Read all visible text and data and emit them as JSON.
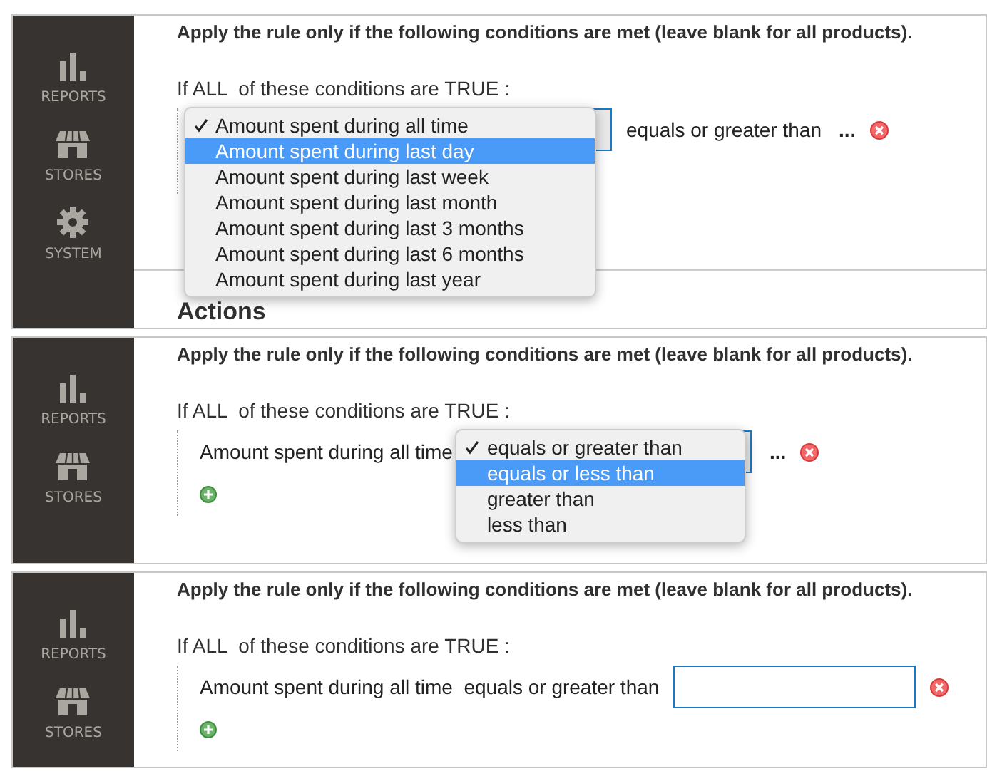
{
  "panels": [
    {
      "sidebar": [
        {
          "kind": "reports",
          "label": "REPORTS"
        },
        {
          "kind": "stores",
          "label": "STORES"
        },
        {
          "kind": "system",
          "label": "SYSTEM"
        }
      ],
      "heading": "Apply the rule only if the following conditions are met (leave blank for all products).",
      "rule": "If ALL  of these conditions are TRUE :",
      "condition": [
        {
          "kind": "select",
          "menu": [
            {
              "label": "Amount spent during all time",
              "checked": true,
              "selected": false
            },
            {
              "label": "Amount spent during last day",
              "checked": false,
              "selected": true
            },
            {
              "label": "Amount spent during last week",
              "checked": false,
              "selected": false
            },
            {
              "label": "Amount spent during last month",
              "checked": false,
              "selected": false
            },
            {
              "label": "Amount spent during last 3 months",
              "checked": false,
              "selected": false
            },
            {
              "label": "Amount spent during last 6 months",
              "checked": false,
              "selected": false
            },
            {
              "label": "Amount spent during last year",
              "checked": false,
              "selected": false
            }
          ]
        },
        {
          "kind": "text",
          "text": "equals or greater than"
        },
        {
          "kind": "link",
          "text": "..."
        },
        {
          "kind": "remove"
        }
      ],
      "section_title": "Actions"
    },
    {
      "sidebar": [
        {
          "kind": "reports",
          "label": "REPORTS"
        },
        {
          "kind": "stores",
          "label": "STORES"
        }
      ],
      "heading": "Apply the rule only if the following conditions are met (leave blank for all products).",
      "rule": "If ALL  of these conditions are TRUE :",
      "condition": [
        {
          "kind": "text",
          "text": "Amount spent during all time"
        },
        {
          "kind": "select",
          "menu": [
            {
              "label": "equals or greater than",
              "checked": true,
              "selected": false
            },
            {
              "label": "equals or less than",
              "checked": false,
              "selected": true
            },
            {
              "label": "greater than",
              "checked": false,
              "selected": false
            },
            {
              "label": "less than",
              "checked": false,
              "selected": false
            }
          ]
        },
        {
          "kind": "link",
          "text": "..."
        },
        {
          "kind": "remove"
        }
      ],
      "row_buttons": [
        {
          "kind": "add"
        }
      ]
    },
    {
      "sidebar": [
        {
          "kind": "reports",
          "label": "REPORTS"
        },
        {
          "kind": "stores",
          "label": "STORES"
        }
      ],
      "heading": "Apply the rule only if the following conditions are met (leave blank for all products).",
      "rule": "If ALL  of these conditions are TRUE :",
      "condition": [
        {
          "kind": "text",
          "text": "Amount spent during all time  equals or greater than"
        },
        {
          "kind": "field"
        },
        {
          "kind": "remove"
        }
      ],
      "row_buttons": [
        {
          "kind": "add"
        }
      ]
    }
  ]
}
